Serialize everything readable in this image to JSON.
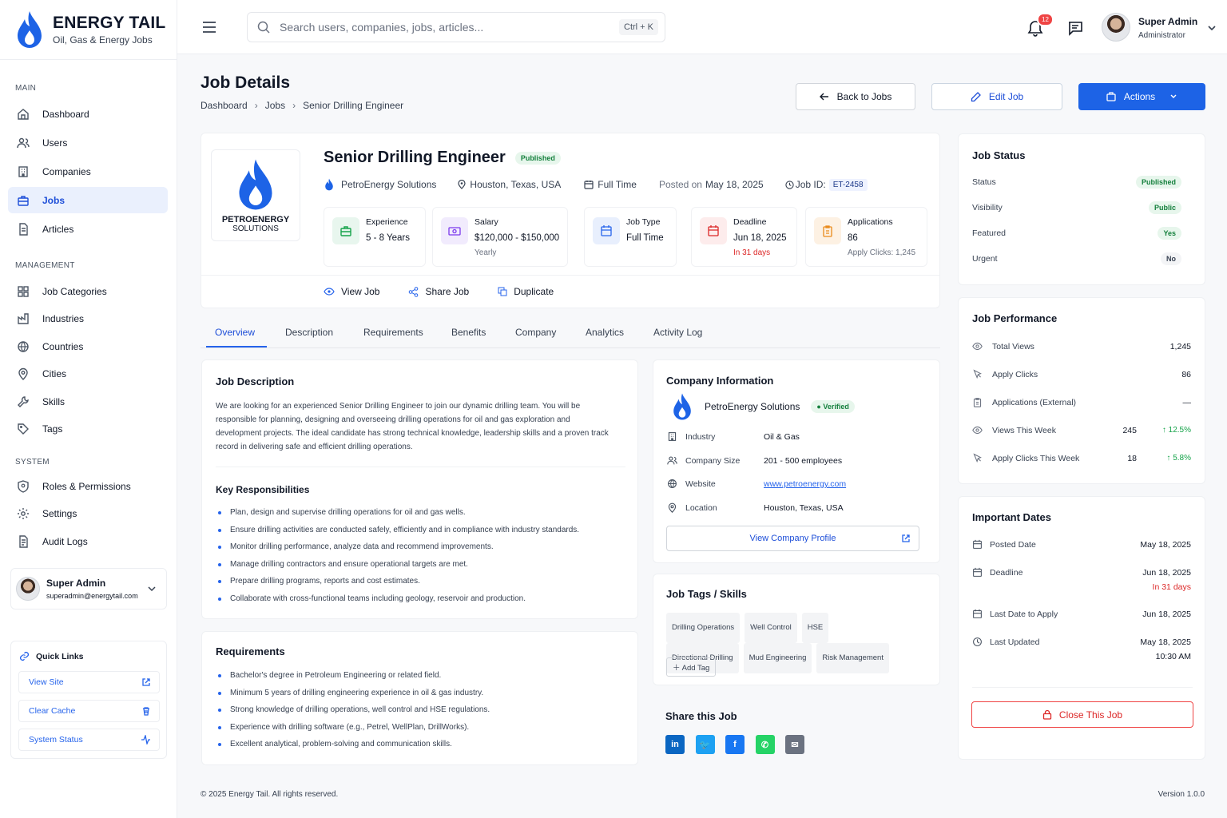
{
  "brand": {
    "name": "ENERGY TAIL",
    "tagline": "Oil, Gas & Energy Jobs"
  },
  "sidebar": {
    "main_label": "MAIN",
    "management_label": "MANAGEMENT",
    "system_label": "SYSTEM",
    "main": [
      {
        "label": "Dashboard",
        "icon": "home-icon"
      },
      {
        "label": "Users",
        "icon": "users-icon"
      },
      {
        "label": "Companies",
        "icon": "building-icon"
      },
      {
        "label": "Jobs",
        "icon": "briefcase-icon",
        "active": true
      },
      {
        "label": "Articles",
        "icon": "document-icon"
      }
    ],
    "management": [
      {
        "label": "Job Categories",
        "icon": "grid-icon"
      },
      {
        "label": "Industries",
        "icon": "factory-icon"
      },
      {
        "label": "Countries",
        "icon": "globe-icon"
      },
      {
        "label": "Cities",
        "icon": "map-pin-icon"
      },
      {
        "label": "Skills",
        "icon": "tool-icon"
      },
      {
        "label": "Tags",
        "icon": "tag-icon"
      }
    ],
    "system": [
      {
        "label": "Roles & Permissions",
        "icon": "shield-icon"
      },
      {
        "label": "Settings",
        "icon": "gear-icon"
      },
      {
        "label": "Audit Logs",
        "icon": "log-icon"
      }
    ],
    "user": {
      "name": "Super Admin",
      "email": "superadmin@energytail.com"
    },
    "quick_links": {
      "title": "Quick Links",
      "items": [
        {
          "label": "View Site",
          "icon": "external-link-icon"
        },
        {
          "label": "Clear Cache",
          "icon": "trash-icon"
        },
        {
          "label": "System Status",
          "icon": "activity-icon"
        }
      ]
    }
  },
  "topbar": {
    "search_placeholder": "Search users, companies, jobs, articles...",
    "shortcut": "Ctrl + K",
    "notifications": "12",
    "user_name": "Super Admin",
    "user_role": "Administrator"
  },
  "page": {
    "title": "Job Details",
    "breadcrumb": [
      "Dashboard",
      "Jobs",
      "Senior Drilling Engineer"
    ],
    "back_label": "Back to Jobs",
    "edit_label": "Edit Job",
    "actions_label": "Actions"
  },
  "job": {
    "company_logo_line1": "PETROENERGY",
    "company_logo_line2": "SOLUTIONS",
    "title": "Senior Drilling Engineer",
    "status": "Published",
    "company": "PetroEnergy Solutions",
    "location": "Houston, Texas, USA",
    "type": "Full Time",
    "posted_prefix": "Posted on",
    "posted_date": "May 18, 2025",
    "id_label": "Job ID:",
    "id": "ET-2458",
    "stats": [
      {
        "label": "Experience",
        "value": "5 - 8 Years",
        "sub": "",
        "icon": "briefcase-icon",
        "color": "#16a34a",
        "bg": "#e8f6ee"
      },
      {
        "label": "Salary",
        "value": "$120,000 - $150,000",
        "sub": "Yearly",
        "icon": "cash-icon",
        "color": "#7c3aed",
        "bg": "#f1ebfd"
      },
      {
        "label": "Job Type",
        "value": "Full Time",
        "sub": "",
        "icon": "calendar-icon",
        "color": "#2563eb",
        "bg": "#e8effd"
      },
      {
        "label": "Deadline",
        "value": "Jun 18, 2025",
        "sub": "In 31 days",
        "icon": "calendar-icon",
        "color": "#dc2626",
        "bg": "#fdecec"
      },
      {
        "label": "Applications",
        "value": "86",
        "sub": "Apply Clicks: 1,245",
        "icon": "clipboard-icon",
        "color": "#ea8a1a",
        "bg": "#fdf1e3"
      }
    ],
    "view_label": "View Job",
    "share_label": "Share Job",
    "duplicate_label": "Duplicate"
  },
  "tabs": [
    "Overview",
    "Description",
    "Requirements",
    "Benefits",
    "Company",
    "Analytics",
    "Activity Log"
  ],
  "description": {
    "title": "Job Description",
    "text": "We are looking for an experienced Senior Drilling Engineer to join our dynamic drilling team. You will be responsible for planning, designing and overseeing drilling operations for oil and gas exploration and development projects. The ideal candidate has strong technical knowledge, leadership skills and a proven track record in delivering safe and efficient drilling operations.",
    "resp_title": "Key Responsibilities",
    "responsibilities": [
      "Plan, design and supervise drilling operations for oil and gas wells.",
      "Ensure drilling activities are conducted safely, efficiently and in compliance with industry standards.",
      "Monitor drilling performance, analyze data and recommend improvements.",
      "Manage drilling contractors and ensure operational targets are met.",
      "Prepare drilling programs, reports and cost estimates.",
      "Collaborate with cross-functional teams including geology, reservoir and production."
    ]
  },
  "requirements": {
    "title": "Requirements",
    "items": [
      "Bachelor's degree in Petroleum Engineering or related field.",
      "Minimum 5 years of drilling engineering experience in oil & gas industry.",
      "Strong knowledge of drilling operations, well control and HSE regulations.",
      "Experience with drilling software (e.g., Petrel, WellPlan, DrillWorks).",
      "Excellent analytical, problem-solving and communication skills."
    ]
  },
  "company_info": {
    "title": "Company Information",
    "name": "PetroEnergy Solutions",
    "verified": "Verified",
    "rows": [
      {
        "label": "Industry",
        "value": "Oil & Gas",
        "icon": "building-icon"
      },
      {
        "label": "Company Size",
        "value": "201 - 500 employees",
        "icon": "users-icon"
      },
      {
        "label": "Website",
        "value": "www.petroenergy.com",
        "icon": "globe-icon"
      },
      {
        "label": "Location",
        "value": "Houston, Texas, USA",
        "icon": "map-pin-icon"
      }
    ],
    "profile_label": "View Company Profile"
  },
  "tags": {
    "title": "Job Tags / Skills",
    "items": [
      "Drilling Operations",
      "Well Control",
      "HSE",
      "Directional Drilling",
      "Mud Engineering",
      "Risk Management"
    ],
    "add_label": "Add Tag"
  },
  "share": {
    "title": "Share this Job",
    "items": [
      {
        "name": "linkedin-icon",
        "glyph": "in",
        "color": "#0a66c2"
      },
      {
        "name": "twitter-icon",
        "glyph": "🐦",
        "color": "#1da1f2"
      },
      {
        "name": "facebook-icon",
        "glyph": "f",
        "color": "#1877f2"
      },
      {
        "name": "whatsapp-icon",
        "glyph": "✆",
        "color": "#25d366"
      },
      {
        "name": "email-icon",
        "glyph": "✉",
        "color": "#6b7280"
      }
    ]
  },
  "status_panel": {
    "title": "Job Status",
    "rows": [
      {
        "label": "Status",
        "value": "Published",
        "kind": "green"
      },
      {
        "label": "Visibility",
        "value": "Public",
        "kind": "green"
      },
      {
        "label": "Featured",
        "value": "Yes",
        "kind": "green"
      },
      {
        "label": "Urgent",
        "value": "No",
        "kind": "gray"
      }
    ]
  },
  "performance": {
    "title": "Job Performance",
    "rows": [
      {
        "label": "Total Views",
        "value": "1,245",
        "delta": "",
        "icon": "eye-icon"
      },
      {
        "label": "Apply Clicks",
        "value": "86",
        "delta": "",
        "icon": "cursor-icon"
      },
      {
        "label": "Applications (External)",
        "value": "—",
        "delta": "",
        "icon": "clipboard-icon"
      },
      {
        "label": "Views This Week",
        "value": "245",
        "delta": "12.5%",
        "icon": "eye-icon"
      },
      {
        "label": "Apply Clicks This Week",
        "value": "18",
        "delta": "5.8%",
        "icon": "cursor-icon"
      }
    ]
  },
  "dates": {
    "title": "Important Dates",
    "rows": [
      {
        "label": "Posted Date",
        "value": "May 18, 2025",
        "sub": ""
      },
      {
        "label": "Deadline",
        "value": "Jun 18, 2025",
        "sub": "In 31 days"
      },
      {
        "label": "Last Date to Apply",
        "value": "Jun 18, 2025",
        "sub": ""
      },
      {
        "label": "Last Updated",
        "value": "May 18, 2025",
        "sub": "10:30 AM"
      }
    ],
    "close_label": "Close This Job"
  },
  "footer": {
    "copyright": "© 2025 Energy Tail. All rights reserved.",
    "version": "Version 1.0.0"
  }
}
